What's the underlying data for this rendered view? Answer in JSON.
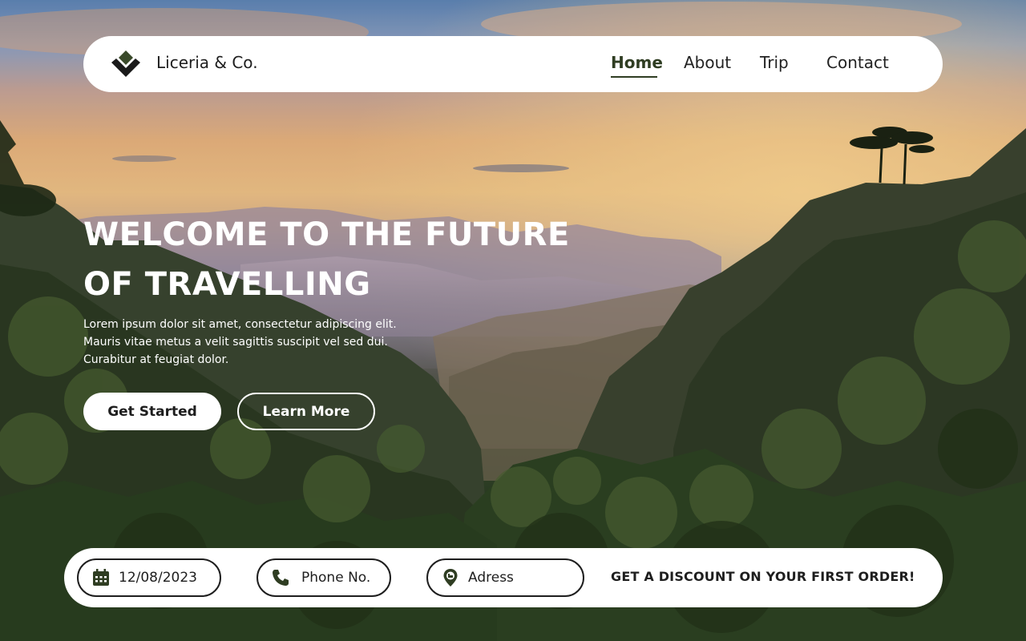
{
  "brand": {
    "name": "Liceria & Co.",
    "logo_icon": "diamond-chevron-logo",
    "accent": "#2f3d22"
  },
  "nav": {
    "items": [
      {
        "label": "Home",
        "active": true
      },
      {
        "label": "About",
        "active": false
      },
      {
        "label": "Trip",
        "active": false
      },
      {
        "label": "Contact",
        "active": false
      }
    ]
  },
  "hero": {
    "headline_line1": "WELCOME TO THE FUTURE",
    "headline_line2": "OF TRAVELLING",
    "sub_line1": "Lorem ipsum dolor sit amet, consectetur adipiscing elit.",
    "sub_line2": "Mauris vitae metus a velit sagittis suscipit vel sed dui.",
    "sub_line3": "Curabitur at feugiat dolor.",
    "primary_button": "Get Started",
    "secondary_button": "Learn More"
  },
  "booking": {
    "date_value": "12/08/2023",
    "date_icon": "calendar-icon",
    "phone_placeholder": "Phone No.",
    "phone_icon": "phone-icon",
    "address_placeholder": "Adress",
    "address_icon": "location-pin-icon",
    "cta": "GET A DISCOUNT ON YOUR FIRST ORDER!"
  }
}
